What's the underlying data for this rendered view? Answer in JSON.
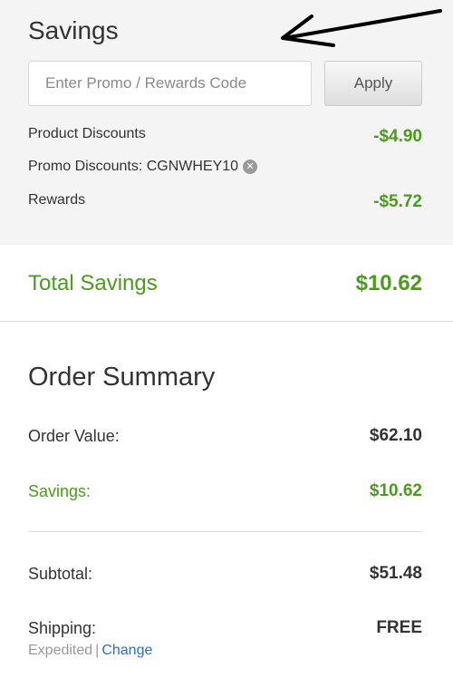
{
  "savings": {
    "title": "Savings",
    "promo_placeholder": "Enter Promo / Rewards Code",
    "apply_label": "Apply",
    "discounts": [
      {
        "label": "Product Discounts",
        "value": "-$4.90"
      },
      {
        "label": "Promo Discounts: CGNWHEY10",
        "value": ""
      },
      {
        "label": "Rewards",
        "value": "-$5.72"
      }
    ]
  },
  "total_savings": {
    "label": "Total Savings",
    "value": "$10.62"
  },
  "order_summary": {
    "title": "Order Summary",
    "order_value": {
      "label": "Order Value:",
      "value": "$62.10"
    },
    "savings": {
      "label": "Savings:",
      "value": "$10.62"
    },
    "subtotal": {
      "label": "Subtotal:",
      "value": "$51.48"
    },
    "shipping": {
      "label": "Shipping:",
      "value": "FREE",
      "method": "Expedited",
      "separator": "|",
      "change_label": "Change"
    }
  },
  "colors": {
    "accent_green": "#4c9a20",
    "link_blue": "#2a6fc9",
    "panel_bg": "#f4f4f4"
  },
  "icons": {
    "remove_promo": "circle-x-icon",
    "annotation": "arrow-pointer-icon"
  }
}
